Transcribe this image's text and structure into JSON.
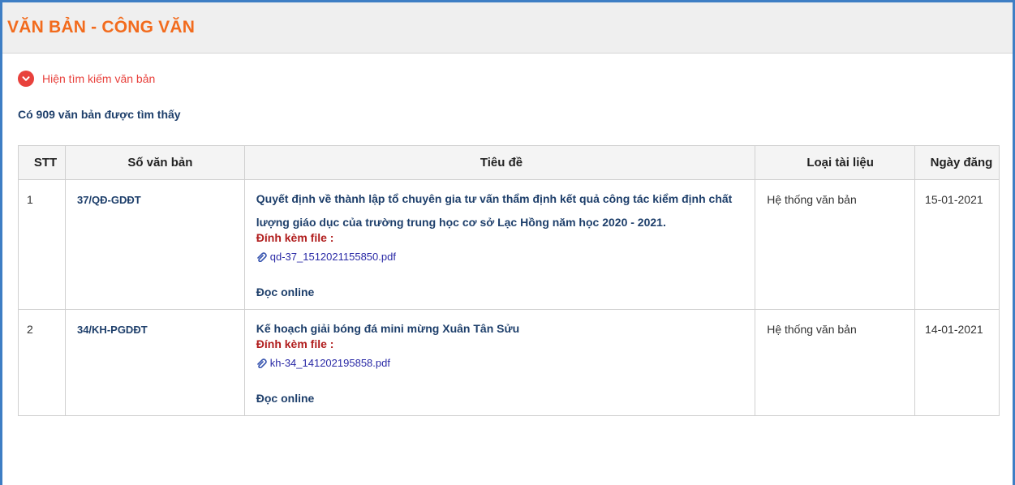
{
  "header": {
    "title": "VĂN BẢN - CÔNG VĂN"
  },
  "search_toggle": {
    "label": "Hiện tìm kiếm văn bản",
    "icon": "chevron-down-icon"
  },
  "result_count": "Có 909 văn bản được tìm thấy",
  "table": {
    "columns": [
      "STT",
      "Số văn bản",
      "Tiêu đề",
      "Loại tài liệu",
      "Ngày đăng"
    ],
    "rows": [
      {
        "stt": "1",
        "number": "37/QĐ-GDĐT",
        "title": "Quyết định về thành lập tổ chuyên gia tư vấn thẩm định kết quả công tác kiểm định chất lượng giáo dục của trường trung học cơ sở Lạc Hồng năm học 2020 - 2021.",
        "attach_label": "Đính kèm file :",
        "file": "qd-37_1512021155850.pdf",
        "read_online": "Đọc online",
        "type": "Hệ thống văn bản",
        "date": "15-01-2021"
      },
      {
        "stt": "2",
        "number": "34/KH-PGDĐT",
        "title": "Kế hoạch giải bóng đá mini mừng Xuân Tân Sửu",
        "attach_label": "Đính kèm file :",
        "file": "kh-34_141202195858.pdf",
        "read_online": "Đọc online",
        "type": "Hệ thống văn bản",
        "date": "14-01-2021"
      }
    ]
  },
  "colors": {
    "accent_orange": "#f26b1d",
    "toggle_red": "#e8413c",
    "link_blue": "#1e3f6b",
    "attach_red": "#b11e1e",
    "frame_blue": "#3e7ec4"
  }
}
